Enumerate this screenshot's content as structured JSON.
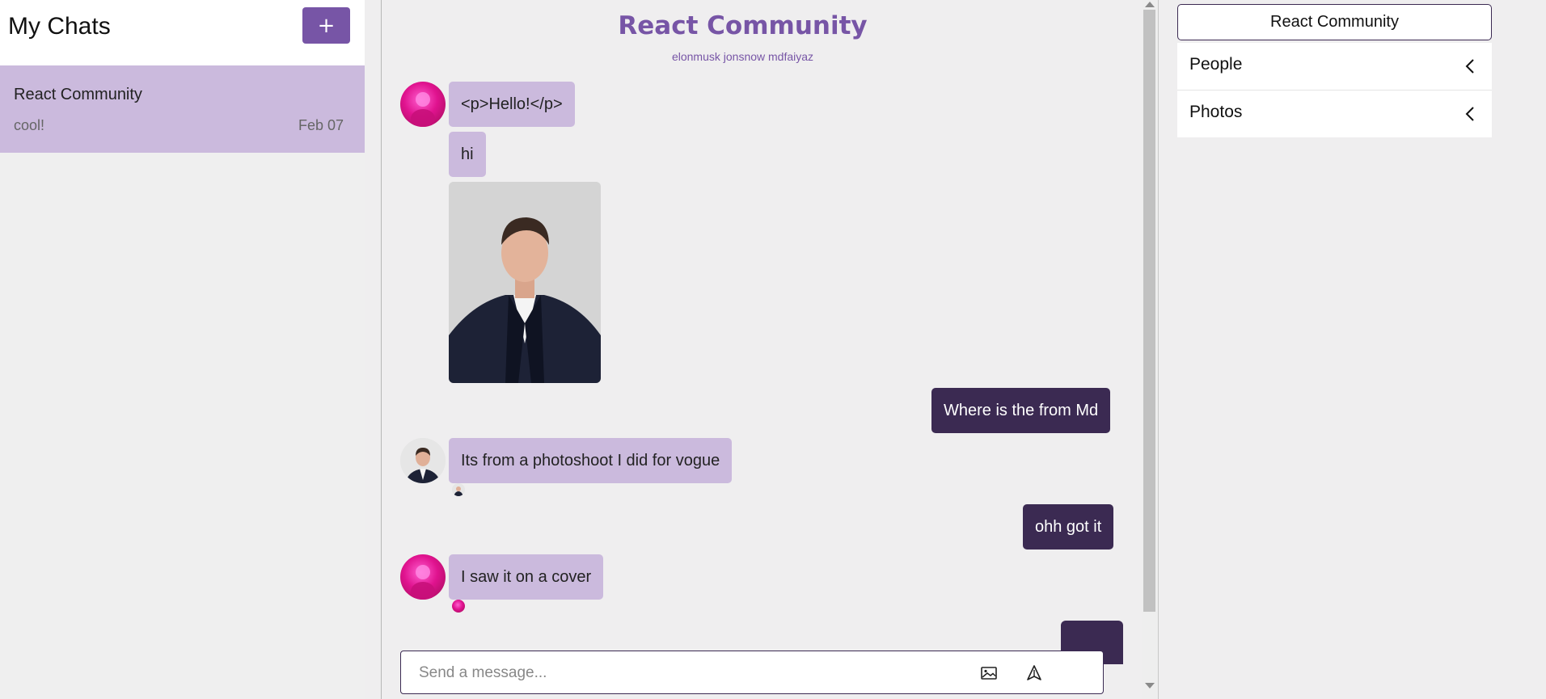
{
  "sidebar": {
    "title": "My Chats",
    "add_button_label": "+",
    "chats": [
      {
        "name": "React Community",
        "last_message": "cool!",
        "date": "Feb 07"
      }
    ]
  },
  "room": {
    "title": "React Community",
    "members": "elonmusk jonsnow mdfaiyaz"
  },
  "messages": [
    {
      "text": "<p>Hello!</p>",
      "direction": "incoming"
    },
    {
      "text": "hi",
      "direction": "incoming"
    },
    {
      "text": "",
      "direction": "incoming",
      "type": "image"
    },
    {
      "text": "Where is the from Md",
      "direction": "outgoing"
    },
    {
      "text": "Its from a photoshoot I did for vogue",
      "direction": "incoming"
    },
    {
      "text": "ohh got it",
      "direction": "outgoing"
    },
    {
      "text": "I saw it on a cover",
      "direction": "incoming"
    }
  ],
  "composer": {
    "placeholder": "Send a message..."
  },
  "settings": {
    "room_title": "React Community",
    "sections": [
      "People",
      "Photos"
    ]
  },
  "colors": {
    "accent": "#7755a6",
    "incoming_bubble": "#cbbadd",
    "outgoing_bubble": "#3b2a52"
  }
}
